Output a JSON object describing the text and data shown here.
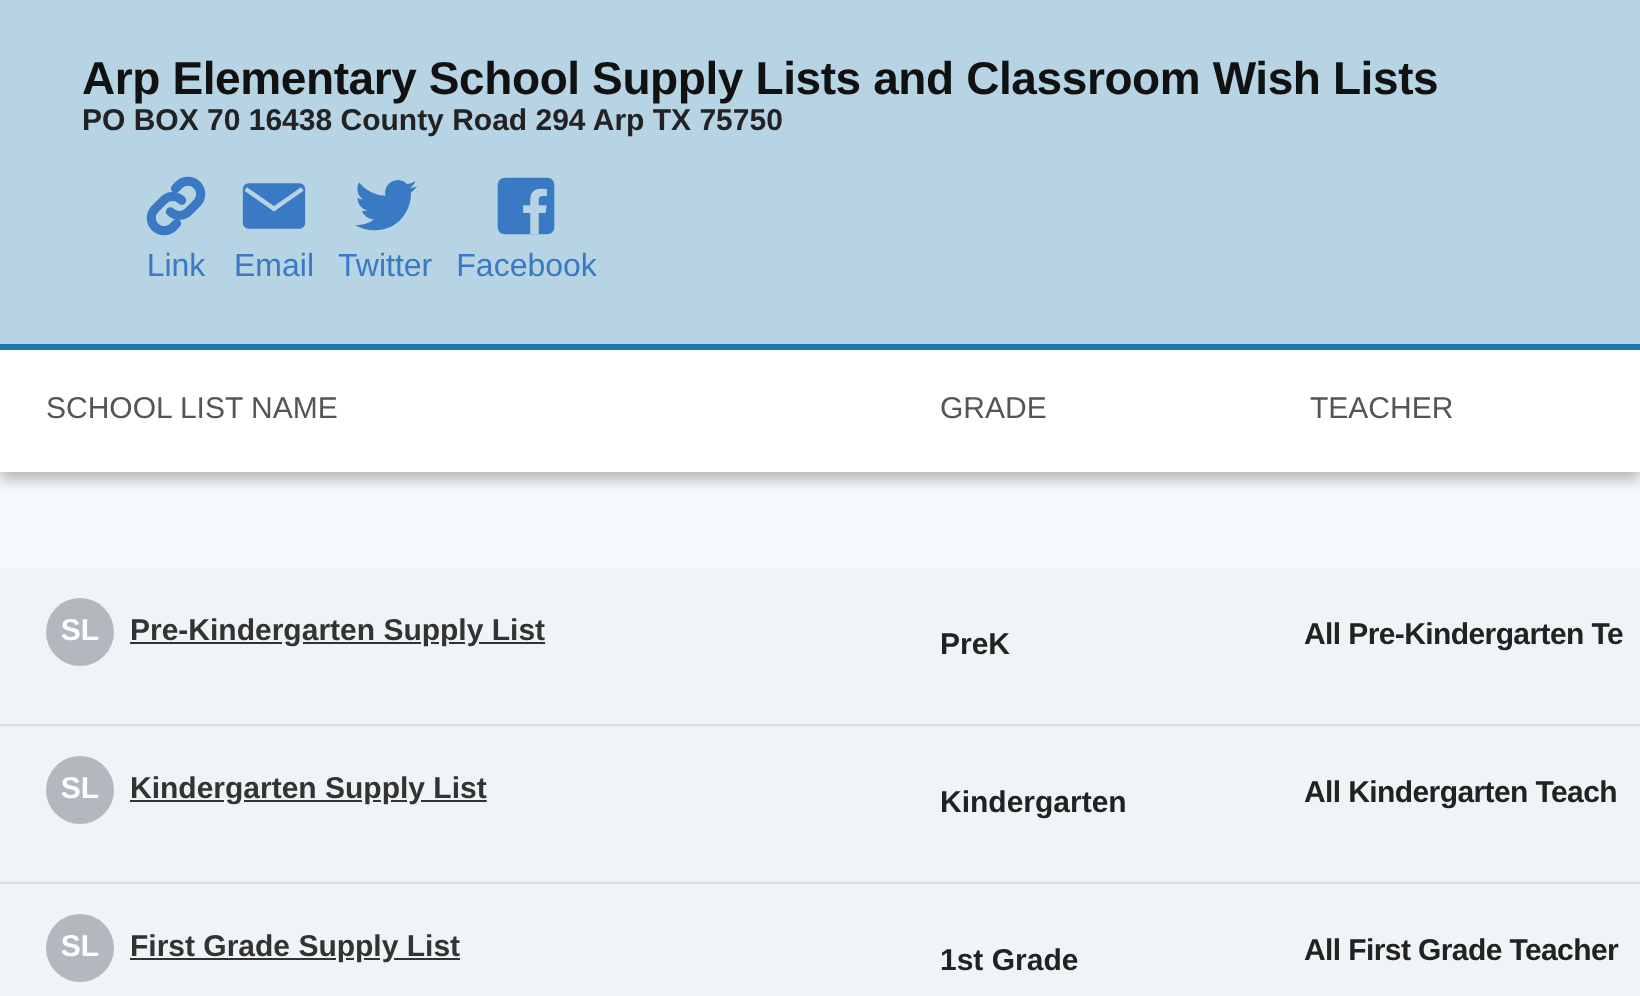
{
  "header": {
    "title": "Arp Elementary School Supply Lists and Classroom Wish Lists",
    "address": "PO BOX 70 16438 County Road 294 Arp TX 75750",
    "share_links": [
      {
        "kind": "link",
        "label": "Link"
      },
      {
        "kind": "email",
        "label": "Email"
      },
      {
        "kind": "twitter",
        "label": "Twitter"
      },
      {
        "kind": "facebook",
        "label": "Facebook"
      }
    ]
  },
  "table": {
    "columns": [
      "SCHOOL LIST NAME",
      "GRADE",
      "TEACHER"
    ],
    "rows": [
      {
        "avatar": "SL",
        "name": "Pre-Kindergarten Supply List",
        "grade": "PreK",
        "teacher": "All Pre-Kindergarten Te"
      },
      {
        "avatar": "SL",
        "name": "Kindergarten Supply List",
        "grade": "Kindergarten",
        "teacher": "All Kindergarten Teach"
      },
      {
        "avatar": "SL",
        "name": "First Grade Supply List",
        "grade": "1st Grade",
        "teacher": "All First Grade Teacher"
      }
    ]
  }
}
